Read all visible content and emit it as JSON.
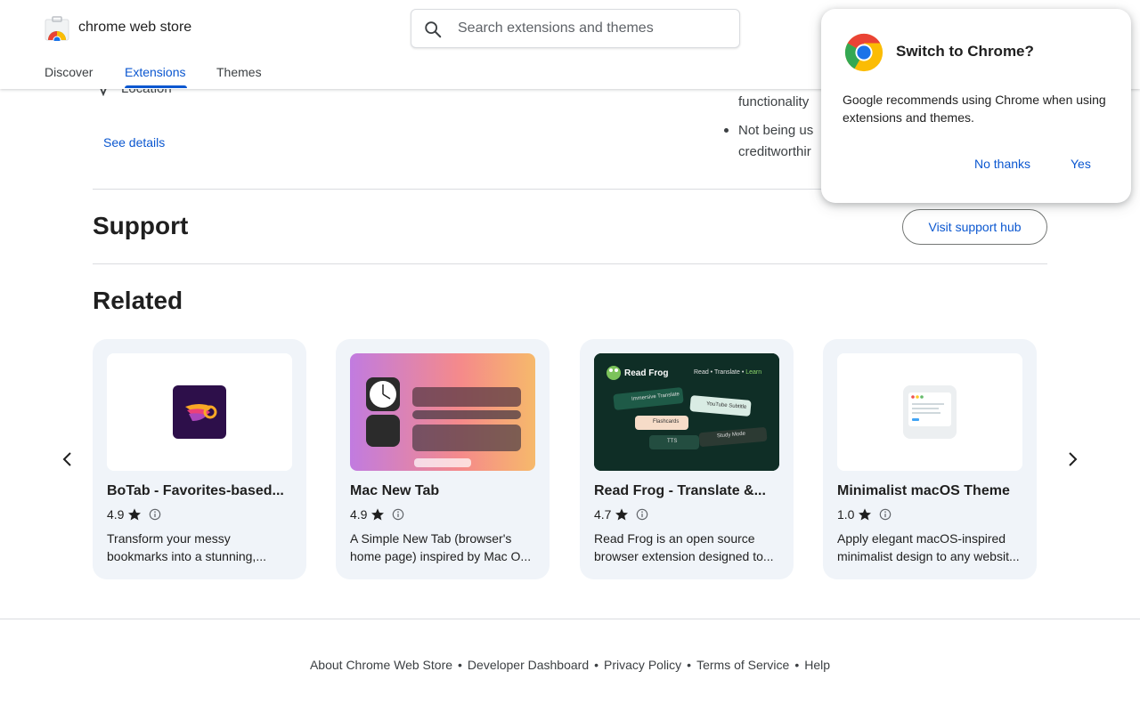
{
  "header": {
    "brand": "chrome web store",
    "search_placeholder": "Search extensions and themes",
    "tabs": [
      {
        "label": "Discover"
      },
      {
        "label": "Extensions",
        "active": true
      },
      {
        "label": "Themes"
      }
    ]
  },
  "privacy": {
    "location_label": "Location",
    "see_details": "See details",
    "frag_functionality": "functionality",
    "frag_not_being": "Not being us",
    "frag_credit": "creditworthir"
  },
  "support": {
    "title": "Support",
    "button": "Visit support hub"
  },
  "related": {
    "title": "Related",
    "cards": [
      {
        "title": "BoTab - Favorites-based...",
        "rating": "4.9",
        "description": "Transform your messy bookmarks into a stunning,..."
      },
      {
        "title": "Mac New Tab",
        "rating": "4.9",
        "description": "A Simple New Tab (browser's home page) inspired by Mac O..."
      },
      {
        "title": "Read Frog - Translate &...",
        "rating": "4.7",
        "description": "Read Frog is an open source browser extension designed to..."
      },
      {
        "title": "Minimalist macOS Theme",
        "rating": "1.0",
        "description": "Apply elegant macOS-inspired minimalist design to any websit..."
      }
    ],
    "thumb_text": {
      "readfrog_brand": "Read Frog",
      "readfrog_tagline": "Read • Translate •",
      "readfrog_tagline_accent": "Learn",
      "readfrog_chip1": "Immersive Translate",
      "readfrog_chip2": "YouTube Subtitle",
      "readfrog_chip3": "Flashcards",
      "readfrog_chip4": "TTS",
      "readfrog_chip5": "Study Mode"
    }
  },
  "footer": {
    "links": [
      "About Chrome Web Store",
      "Developer Dashboard",
      "Privacy Policy",
      "Terms of Service",
      "Help"
    ]
  },
  "popup": {
    "title": "Switch to Chrome?",
    "body": "Google recommends using Chrome when using extensions and themes.",
    "no_thanks": "No thanks",
    "yes": "Yes"
  },
  "colors": {
    "accent": "#0b57d0",
    "card_bg": "#f0f4f9",
    "text": "#1f1f1f"
  }
}
